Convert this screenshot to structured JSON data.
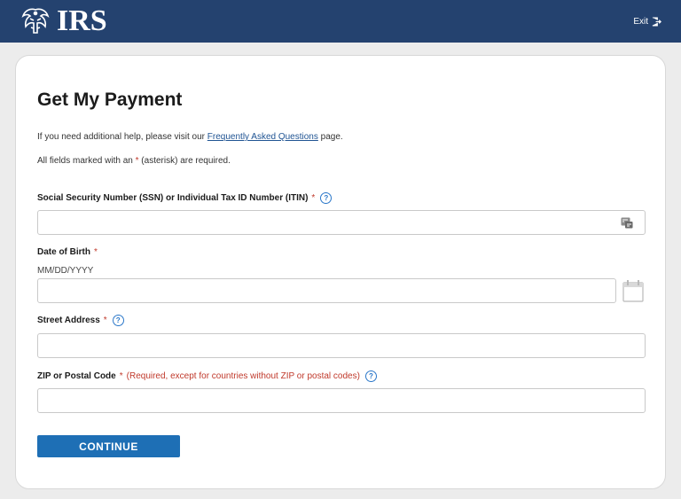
{
  "header": {
    "logo_text": "IRS",
    "exit_label": "Exit",
    "bg_color": "#24426f"
  },
  "page": {
    "title": "Get My Payment",
    "help_prefix": "If you need additional help, please visit our",
    "help_link": "Frequently Asked Questions",
    "help_suffix": "page.",
    "required_prefix": "All fields marked with an",
    "required_star": "*",
    "required_suffix": "(asterisk) are required."
  },
  "form": {
    "ssn": {
      "label": "Social Security Number (SSN) or Individual Tax ID Number (ITIN)",
      "star": "*",
      "value": "",
      "help_icon": "question-icon",
      "field_icon": "id-card-icon"
    },
    "dob": {
      "label": "Date of Birth",
      "star": "*",
      "hint": "MM/DD/YYYY",
      "value": "",
      "field_icon": "calendar-icon"
    },
    "street": {
      "label": "Street Address",
      "star": "*",
      "value": "",
      "help_icon": "question-icon"
    },
    "zip": {
      "label": "ZIP or Postal Code",
      "star": "*",
      "note": "(Required, except for countries without ZIP or postal codes)",
      "value": "",
      "help_icon": "question-icon"
    },
    "continue_label": "CONTINUE",
    "accent_color": "#1e6fb5"
  }
}
